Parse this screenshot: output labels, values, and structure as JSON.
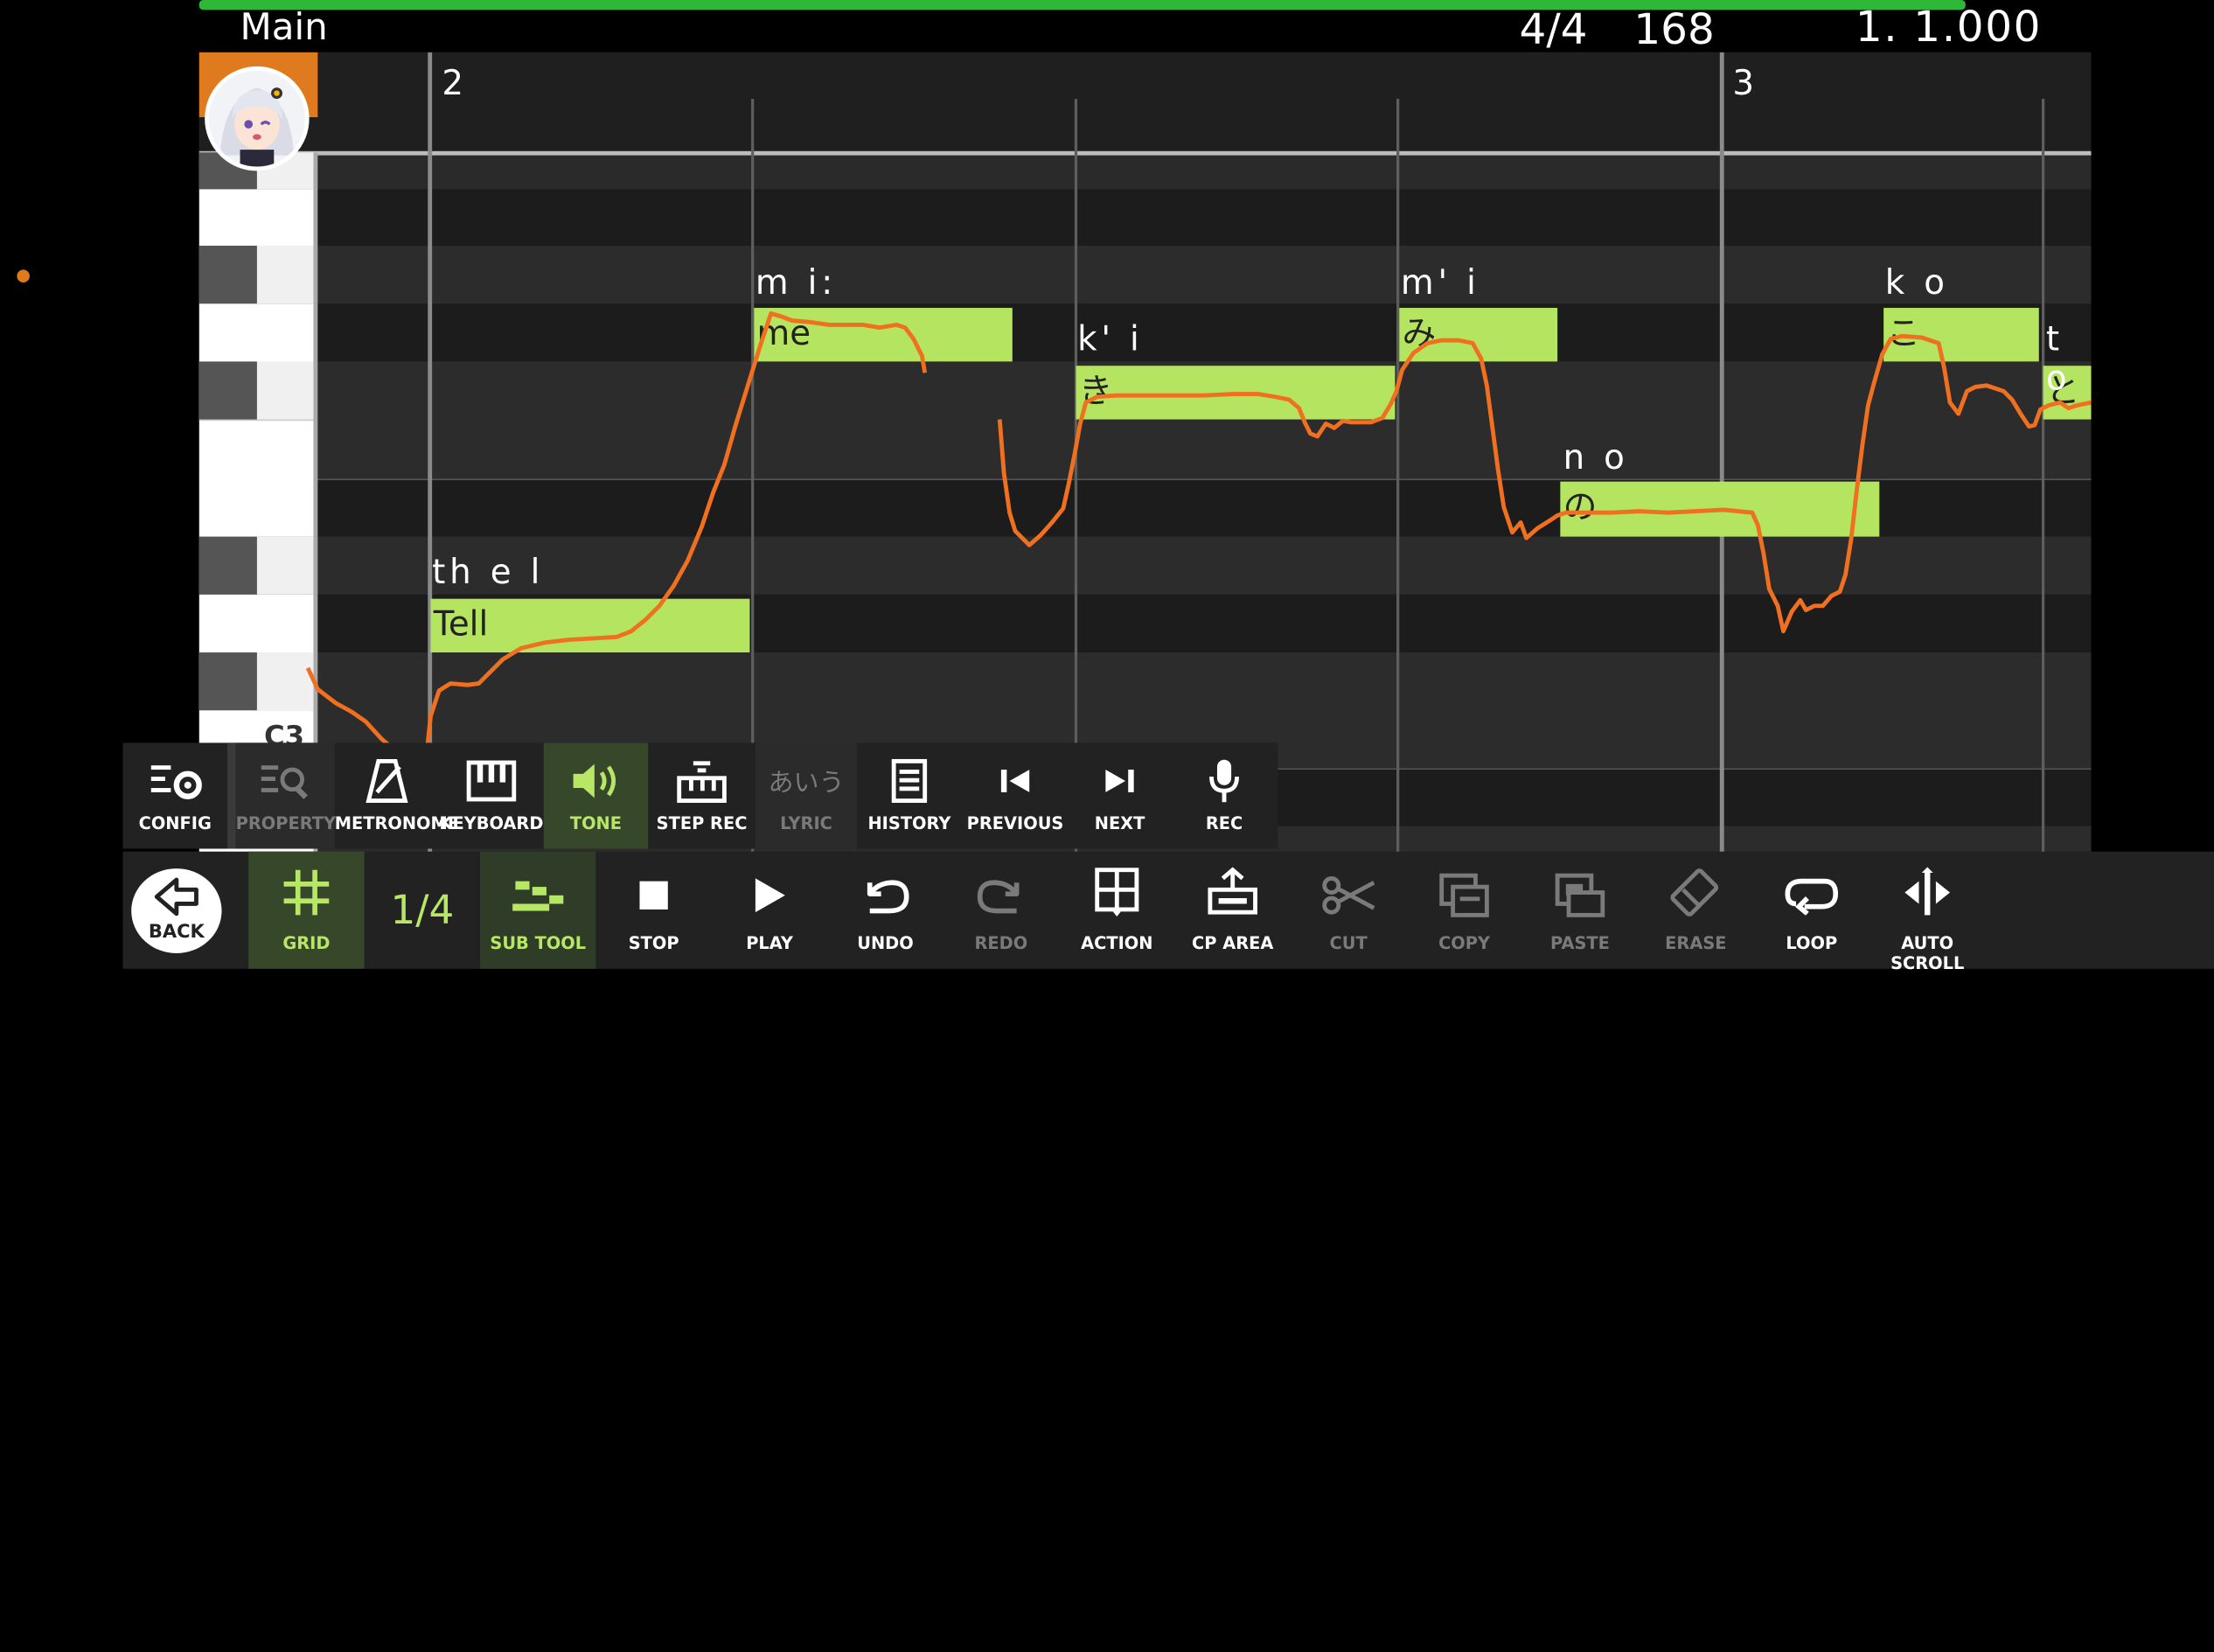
{
  "header": {
    "track_name": "Main",
    "time_signature": "4/4",
    "tempo": "168",
    "position": "1. 1.000",
    "accent_color": "#2fb838"
  },
  "editor": {
    "bar_numbers": [
      "2",
      "3"
    ],
    "octave_label": "C3",
    "note_color": "#b4e460",
    "pitch_color": "#f07020",
    "notes": [
      {
        "lyric": "Tell",
        "phoneme": "th e l"
      },
      {
        "lyric": "me",
        "phoneme": "m i:"
      },
      {
        "lyric": "き",
        "phoneme": "k' i"
      },
      {
        "lyric": "み",
        "phoneme": "m' i"
      },
      {
        "lyric": "の",
        "phoneme": "n o"
      },
      {
        "lyric": "こ",
        "phoneme": "k o"
      },
      {
        "lyric": "と",
        "phoneme": "t o"
      }
    ]
  },
  "subtoolbar": [
    {
      "label": "CONFIG",
      "icon": "config-icon"
    },
    {
      "label": "PROPERTY",
      "icon": "property-icon"
    },
    {
      "label": "METRONOME",
      "icon": "metronome-icon"
    },
    {
      "label": "KEYBOARD",
      "icon": "keyboard-icon"
    },
    {
      "label": "TONE",
      "icon": "speaker-icon"
    },
    {
      "label": "STEP REC",
      "icon": "step-rec-icon"
    },
    {
      "label": "LYRIC",
      "icon": "lyric-icon",
      "glyph": "あいう"
    },
    {
      "label": "HISTORY",
      "icon": "history-icon"
    },
    {
      "label": "PREVIOUS",
      "icon": "previous-icon"
    },
    {
      "label": "NEXT",
      "icon": "next-icon"
    },
    {
      "label": "REC",
      "icon": "microphone-icon"
    }
  ],
  "toolbar": {
    "back": "BACK",
    "grid": "GRID",
    "grid_value": "1/4",
    "subtool": "SUB TOOL",
    "stop": "STOP",
    "play": "PLAY",
    "undo": "UNDO",
    "redo": "REDO",
    "action": "ACTION",
    "cp_area": "CP AREA",
    "cut": "CUT",
    "copy": "COPY",
    "paste": "PASTE",
    "erase": "ERASE",
    "loop": "LOOP",
    "autoscroll": "AUTO SCROLL"
  }
}
